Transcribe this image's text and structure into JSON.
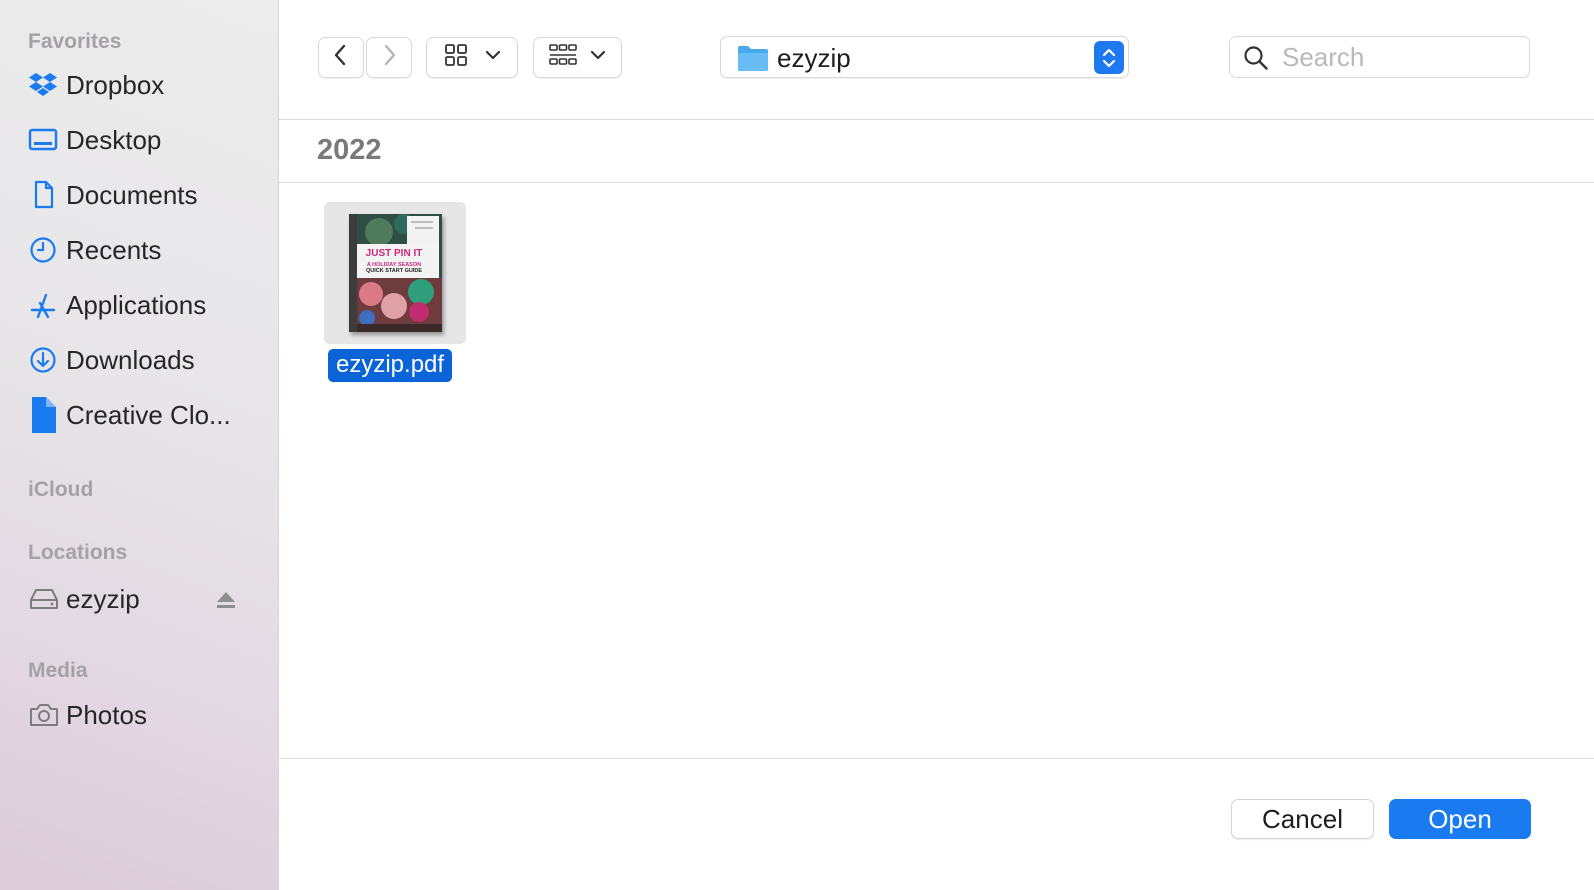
{
  "sidebar": {
    "sections": {
      "favorites": "Favorites",
      "icloud": "iCloud",
      "locations": "Locations",
      "media": "Media"
    },
    "favorites": [
      {
        "label": "Dropbox",
        "icon": "dropbox-icon"
      },
      {
        "label": "Desktop",
        "icon": "desktop-icon"
      },
      {
        "label": "Documents",
        "icon": "document-icon"
      },
      {
        "label": "Recents",
        "icon": "clock-icon"
      },
      {
        "label": "Applications",
        "icon": "applications-icon"
      },
      {
        "label": "Downloads",
        "icon": "download-icon"
      },
      {
        "label": "Creative Clo...",
        "icon": "file-icon"
      }
    ],
    "locations": [
      {
        "label": "ezyzip",
        "icon": "drive-icon",
        "action_icon": "eject-icon"
      }
    ],
    "media": [
      {
        "label": "Photos",
        "icon": "camera-icon"
      }
    ],
    "accent_color": "#1a7bf1"
  },
  "toolbar": {
    "path_label": "ezyzip",
    "search_placeholder": "Search"
  },
  "content": {
    "group_header": "2022",
    "files": [
      {
        "name": "ezyzip.pdf",
        "selected": true,
        "thumbnail_title": "JUST PIN IT",
        "thumbnail_subtitle_1": "A HOLIDAY SEASON",
        "thumbnail_subtitle_2": "QUICK START GUIDE"
      }
    ]
  },
  "footer": {
    "cancel_label": "Cancel",
    "open_label": "Open"
  }
}
